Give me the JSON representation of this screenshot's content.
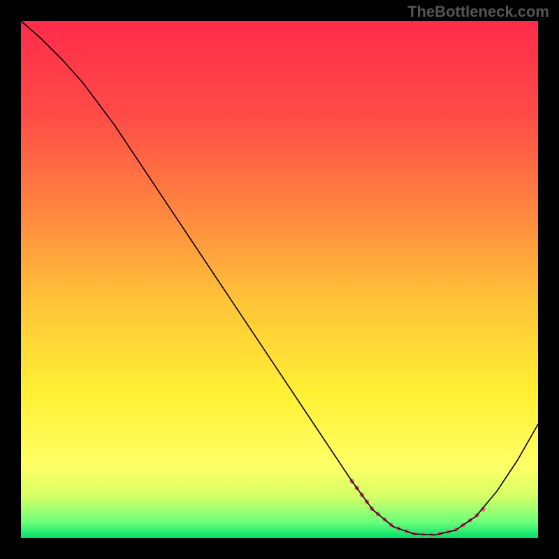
{
  "watermark": "TheBottleneck.com",
  "chart_data": {
    "type": "line",
    "title": "",
    "xlabel": "",
    "ylabel": "",
    "xlim": [
      0,
      100
    ],
    "ylim": [
      0,
      100
    ],
    "gradient_stops": [
      {
        "offset": 0.0,
        "color": "#ff2b4a"
      },
      {
        "offset": 0.18,
        "color": "#ff4b47"
      },
      {
        "offset": 0.38,
        "color": "#ff8a3f"
      },
      {
        "offset": 0.55,
        "color": "#ffc638"
      },
      {
        "offset": 0.72,
        "color": "#fff033"
      },
      {
        "offset": 0.86,
        "color": "#ffff66"
      },
      {
        "offset": 0.92,
        "color": "#d4ff66"
      },
      {
        "offset": 0.97,
        "color": "#6aff7a"
      },
      {
        "offset": 1.0,
        "color": "#00e06a"
      }
    ],
    "series": [
      {
        "name": "curve",
        "color": "#000000",
        "width": 1.6,
        "points": [
          {
            "x": 0,
            "y": 100.0
          },
          {
            "x": 4,
            "y": 96.5
          },
          {
            "x": 8,
            "y": 92.5
          },
          {
            "x": 12,
            "y": 88.0
          },
          {
            "x": 18,
            "y": 80.0
          },
          {
            "x": 26,
            "y": 68.0
          },
          {
            "x": 34,
            "y": 56.0
          },
          {
            "x": 42,
            "y": 44.0
          },
          {
            "x": 50,
            "y": 32.0
          },
          {
            "x": 58,
            "y": 20.0
          },
          {
            "x": 64,
            "y": 11.0
          },
          {
            "x": 68,
            "y": 5.5
          },
          {
            "x": 72,
            "y": 2.2
          },
          {
            "x": 76,
            "y": 0.8
          },
          {
            "x": 80,
            "y": 0.6
          },
          {
            "x": 84,
            "y": 1.5
          },
          {
            "x": 88,
            "y": 4.2
          },
          {
            "x": 92,
            "y": 9.0
          },
          {
            "x": 96,
            "y": 15.0
          },
          {
            "x": 100,
            "y": 22.0
          }
        ]
      },
      {
        "name": "highlight",
        "color": "#d9686d",
        "width": 6.5,
        "points": [
          {
            "x": 64,
            "y": 11.0
          },
          {
            "x": 68,
            "y": 5.5
          },
          {
            "x": 72,
            "y": 2.2
          },
          {
            "x": 76,
            "y": 0.8
          },
          {
            "x": 80,
            "y": 0.6
          },
          {
            "x": 84,
            "y": 1.5
          },
          {
            "x": 88,
            "y": 4.2
          },
          {
            "x": 90,
            "y": 6.2
          }
        ]
      }
    ]
  }
}
